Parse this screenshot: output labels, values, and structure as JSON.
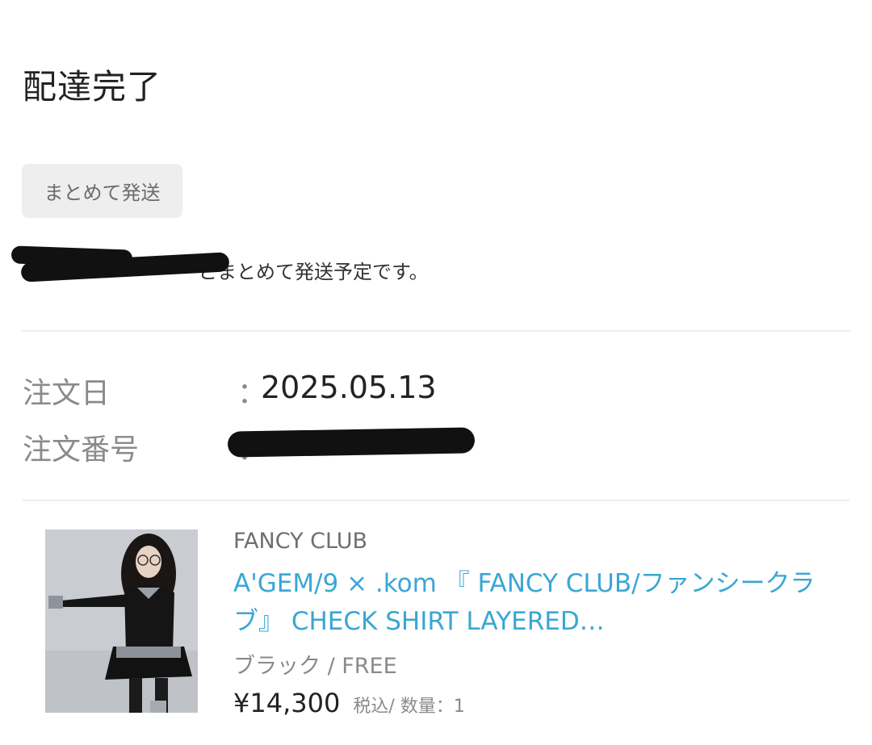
{
  "header": {
    "title": "配達完了"
  },
  "bundle": {
    "badge_label": "まとめて発送",
    "note_text": "とまとめて発送予定です。"
  },
  "order": {
    "date_label": "注文日",
    "date_colon": "：",
    "date_value": "2025.05.13",
    "number_label": "注文番号",
    "number_colon": "："
  },
  "product": {
    "brand": "FANCY CLUB",
    "name": "A'GEM/9 × .kom 『 FANCY CLUB/ファンシークラブ』 CHECK SHIRT LAYERED…",
    "variant": "ブラック / FREE",
    "price": "¥14,300",
    "tax_label": "税込",
    "quantity_label": " / 数量：1"
  }
}
